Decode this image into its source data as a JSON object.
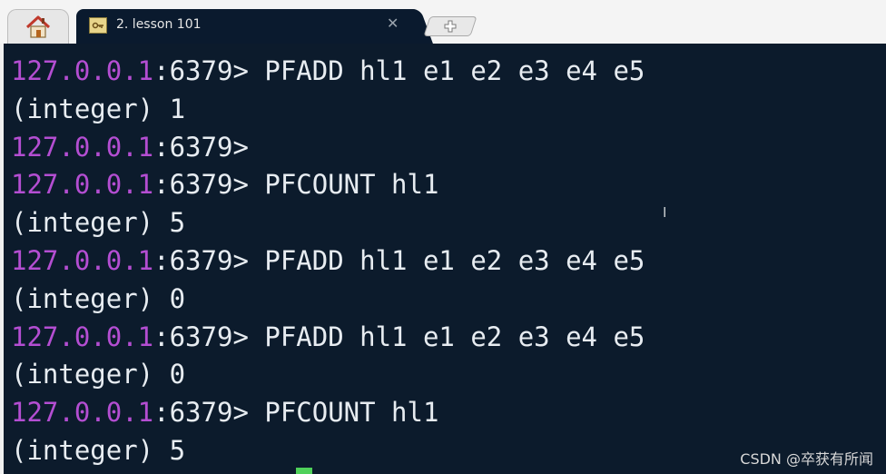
{
  "tabs": {
    "home_icon": "home-icon",
    "session_icon": "key-icon",
    "session_title": "2. lesson 101",
    "close_glyph": "✕",
    "new_tab_icon": "plus-icon"
  },
  "terminal": {
    "lines": [
      {
        "kind": "prompt",
        "ip": "127.0.0.1",
        "port": ":6379>",
        "command": " PFADD hl1 e1 e2 e3 e4 e5"
      },
      {
        "kind": "output",
        "text": "(integer) 1"
      },
      {
        "kind": "prompt",
        "ip": "127.0.0.1",
        "port": ":6379>",
        "command": ""
      },
      {
        "kind": "prompt",
        "ip": "127.0.0.1",
        "port": ":6379>",
        "command": " PFCOUNT hl1"
      },
      {
        "kind": "output",
        "text": "(integer) 5"
      },
      {
        "kind": "prompt",
        "ip": "127.0.0.1",
        "port": ":6379>",
        "command": " PFADD hl1 e1 e2 e3 e4 e5"
      },
      {
        "kind": "output",
        "text": "(integer) 0"
      },
      {
        "kind": "prompt",
        "ip": "127.0.0.1",
        "port": ":6379>",
        "command": " PFADD hl1 e1 e2 e3 e4 e5"
      },
      {
        "kind": "output",
        "text": "(integer) 0"
      },
      {
        "kind": "prompt",
        "ip": "127.0.0.1",
        "port": ":6379>",
        "command": " PFCOUNT hl1"
      },
      {
        "kind": "output",
        "text": "(integer) 5"
      }
    ],
    "ibeam_glyph": "I"
  },
  "watermark": "CSDN @卒获有所闻",
  "colors": {
    "terminal_bg": "#0c1b2c",
    "prompt_ip": "#b44ed2",
    "text": "#e7ecf1",
    "cursor": "#4fd15a"
  }
}
